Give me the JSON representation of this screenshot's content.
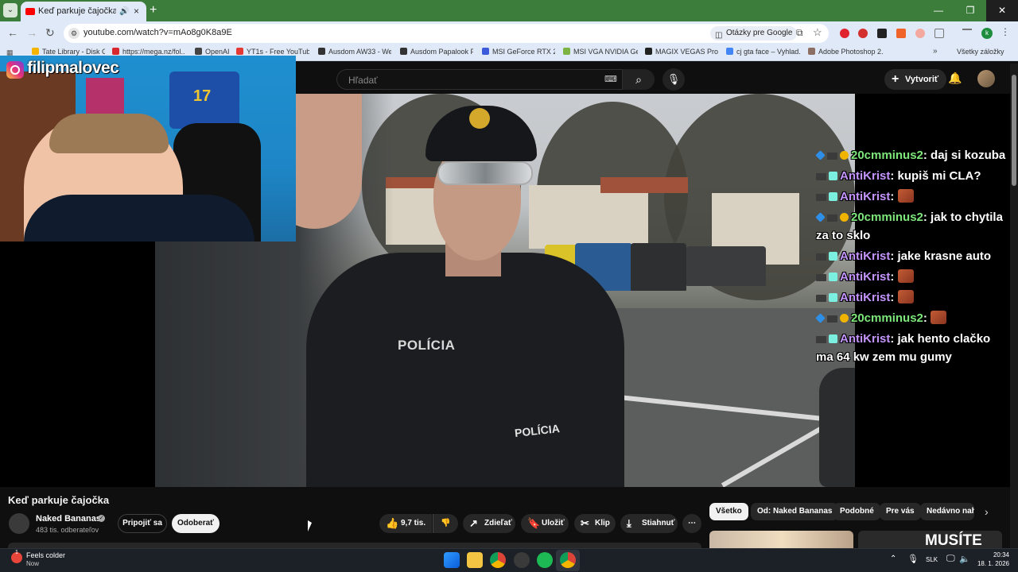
{
  "browser": {
    "tab": {
      "title": "Keď parkuje čajočka - YouTube",
      "close": "×"
    },
    "new_tab": "+",
    "window_controls": {
      "minimize": "—",
      "restore": "❐",
      "close": "✕"
    },
    "toolbar": {
      "back": "←",
      "forward": "→",
      "reload": "↻",
      "url": "youtube.com/watch?v=mAo8g0K8a9E",
      "lens_chip": "Otázky pre Google",
      "star": "☆",
      "profile_initial": "k",
      "menu": "⋮"
    },
    "bookmarks": [
      {
        "label": "Tate Library - Disk G...",
        "color": "#f4b400"
      },
      {
        "label": "https://mega.nz/fol...",
        "color": "#d9272e"
      },
      {
        "label": "OpenAI",
        "color": "#444444"
      },
      {
        "label": "YT1s - Free YouTub...",
        "color": "#e53935"
      },
      {
        "label": "Ausdom AW33 - We...",
        "color": "#333333"
      },
      {
        "label": "Ausdom Papalook P...",
        "color": "#333333"
      },
      {
        "label": "MSI GeForce RTX 20...",
        "color": "#3b5bdb"
      },
      {
        "label": "MSI VGA NVIDIA Ge...",
        "color": "#7cb342"
      },
      {
        "label": "MAGIX VEGAS Pro 1...",
        "color": "#222222"
      },
      {
        "label": "cj gta face – Vyhlad...",
        "color": "#4285f4"
      },
      {
        "label": "Adobe Photoshop 2...",
        "color": "#8d6e63"
      }
    ],
    "bookmarks_more": "»",
    "bookmarks_all": "Všetky záložky"
  },
  "youtube": {
    "search_placeholder": "Hľadať",
    "create_label": "Vytvoriť",
    "video_title": "Keď parkuje čajočka",
    "channel_name": "Naked Bananas",
    "channel_subs": "483 tis. odberateľov",
    "join_label": "Pripojiť sa",
    "subscribe_label": "Odoberať",
    "like_count": "9,7 tis.",
    "share_label": "Zdieľať",
    "save_label": "Uložiť",
    "clip_label": "Klip",
    "download_label": "Stiahnuť",
    "more_label": "⋯",
    "chips": [
      "Všetko",
      "Od: Naked Bananas",
      "Podobné",
      "Pre vás",
      "Nedávno nahrané"
    ],
    "thumb_text": "MUSÍTE"
  },
  "stream_overlay": {
    "instagram_handle": "filipmalovec",
    "jersey_number": "17",
    "chat": [
      {
        "user": "20cmminus2",
        "msg": ": daj si kozuba",
        "style": "a",
        "emote": false
      },
      {
        "user": "AntiKrist",
        "msg": ": kupiš mi CLA?",
        "style": "b",
        "emote": false
      },
      {
        "user": "AntiKrist",
        "msg": ":",
        "style": "b",
        "emote": true
      },
      {
        "user": "20cmminus2",
        "msg": ": jak to chytila za to sklo",
        "style": "a",
        "emote": false
      },
      {
        "user": "AntiKrist",
        "msg": ": jake krasne auto",
        "style": "b",
        "emote": false
      },
      {
        "user": "AntiKrist",
        "msg": ":",
        "style": "b",
        "emote": true
      },
      {
        "user": "AntiKrist",
        "msg": ":",
        "style": "b",
        "emote": true
      },
      {
        "user": "20cmminus2",
        "msg": ":",
        "style": "a",
        "emote": true
      },
      {
        "user": "AntiKrist",
        "msg": ": jak hento clačko ma 64 kw zem mu gumy",
        "style": "b",
        "emote": false
      }
    ]
  },
  "video_scene": {
    "chest_text": "POLÍCIA",
    "arm_text": "POLÍCIA"
  },
  "taskbar": {
    "weather_title": "Feels colder",
    "weather_sub": "Now",
    "weather_badge": "1",
    "language": "SLK",
    "time": "20:34",
    "date": "18. 1. 2026"
  }
}
